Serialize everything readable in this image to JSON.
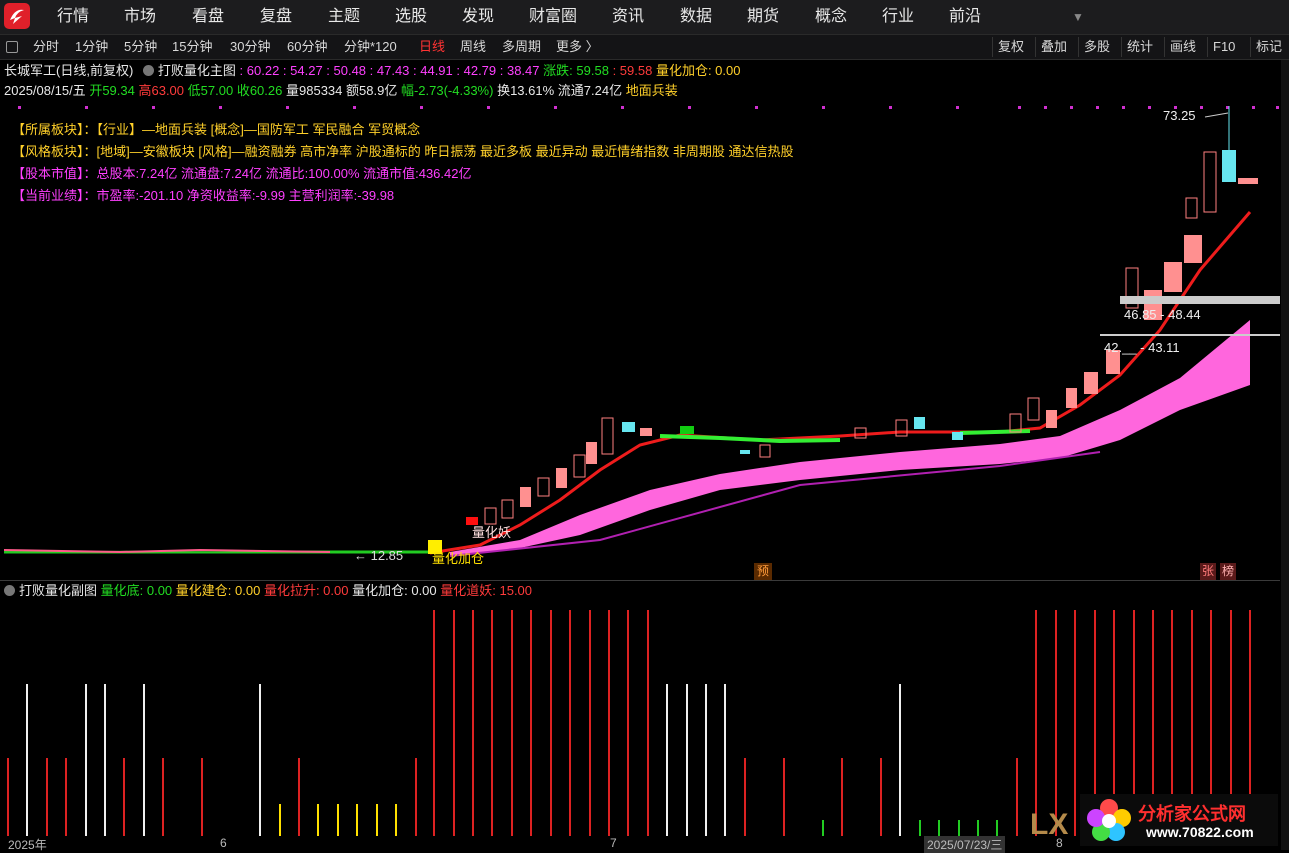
{
  "nav": {
    "items": [
      "行情",
      "市场",
      "看盘",
      "复盘",
      "主题",
      "选股",
      "发现",
      "财富圈",
      "资讯",
      "数据",
      "期货",
      "概念",
      "行业",
      "前沿"
    ]
  },
  "toolbar": {
    "periods": [
      "分时",
      "1分钟",
      "5分钟",
      "15分钟",
      "30分钟",
      "60分钟",
      "分钟*120",
      "日线",
      "周线",
      "多周期",
      "更多 〉"
    ],
    "active": "日线",
    "right": [
      "复权",
      "叠加",
      "多股",
      "统计",
      "画线",
      "F10",
      "标记"
    ]
  },
  "header": {
    "stock": "长城军工(日线,前复权)",
    "indicator": "打败量化主图",
    "values": ": 60.22 : 54.27 : 50.48 : 47.43 : 44.91 : 42.79 : 38.47",
    "zhangdie_label": "涨跌:",
    "zhangdie_value": "59.58",
    "zhangdie_value2": ": 59.58",
    "lhjc": "量化加仓: 0.00",
    "date": "2025/08/15/五",
    "open": "开59.34",
    "high": "高63.00",
    "low": "低57.00",
    "close": "收60.26",
    "vol": "量985334",
    "amount": "额58.9亿",
    "range": "幅-2.73(-4.33%)",
    "turnover": "换13.61%",
    "float": "流通7.24亿",
    "industry": "地面兵装"
  },
  "info": [
    {
      "label": "【所属板块】",
      "text": "：【行业】—地面兵装 [概念]—国防军工 军民融合 军贸概念",
      "color": "#ffd02a"
    },
    {
      "label": "【风格板块】",
      "text": "：[地域]—安徽板块 [风格]—融资融券 高市净率 沪股通标的 昨日振荡 最近多板 最近异动 最近情绪指数 非周期股 通达信热股",
      "color": "#ffd02a"
    },
    {
      "label": "【股本市值】",
      "text": "：总股本:7.24亿 流通盘:7.24亿 流通比:100.00% 流通市值:436.42亿",
      "color": "#ff40ff"
    },
    {
      "label": "【当前业绩】",
      "text": "：市盈率:-201.10 净资收益率:-9.99 主营利润率:-39.98",
      "color": "#ff40ff"
    }
  ],
  "chart_labels": {
    "peak": "73.25",
    "level1": "46.85 - 48.44",
    "level2": "42.__ - 43.11",
    "low_arrow": "← 12.85",
    "tag1": "量化妖",
    "tag2": "量化加仓",
    "marker_yu": "预",
    "marker_zhang": "张",
    "marker_bang": "榜"
  },
  "sub": {
    "title": "打败量化副图",
    "items": [
      {
        "text": "量化底: 0.00",
        "color": "#22dd22"
      },
      {
        "text": "量化建仓: 0.00",
        "color": "#ffd02a"
      },
      {
        "text": "量化拉升: 0.00",
        "color": "#ff3b3b"
      },
      {
        "text": "量化加仓: 0.00",
        "color": "#e8e8e8"
      },
      {
        "text": "量化道妖: 15.00",
        "color": "#ff3b3b"
      }
    ]
  },
  "axis": {
    "labels": [
      "2025年",
      "6",
      "7",
      "2025/07/23/三",
      "8"
    ]
  },
  "watermark": {
    "line1": "分析家公式网",
    "line2": "www.70822.com",
    "lx": "LX"
  },
  "chart_data": {
    "type": "candlestick",
    "ohlc_recent": [
      [
        59.34,
        63.0,
        57.0,
        60.26
      ]
    ],
    "peak": 73.25,
    "levels": [
      [
        46.85,
        48.44
      ],
      [
        42.0,
        43.11
      ]
    ],
    "low_marker": 12.85
  }
}
